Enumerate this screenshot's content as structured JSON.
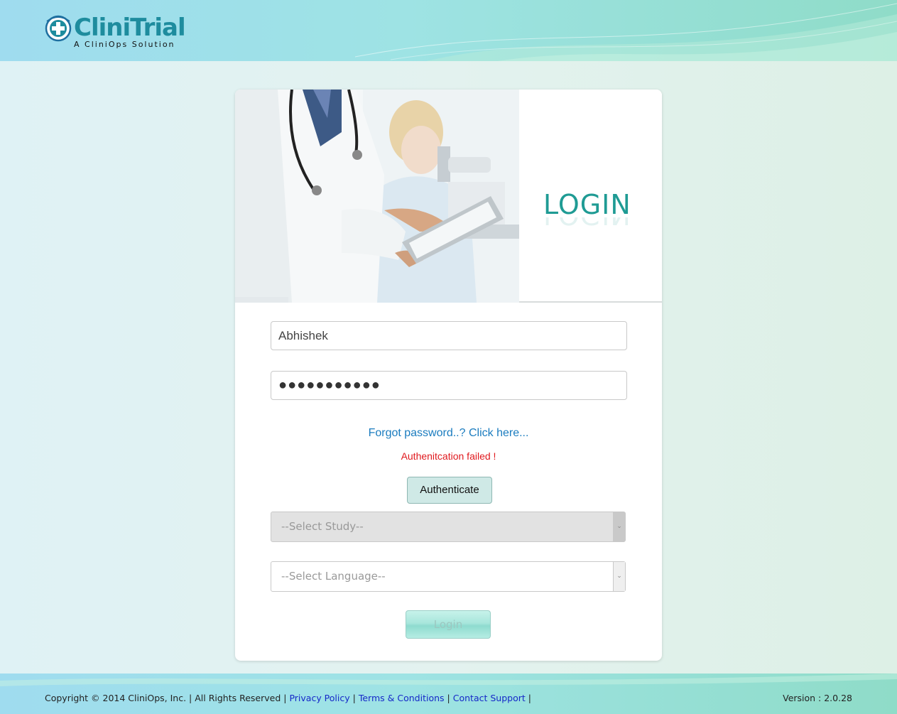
{
  "brand": {
    "name": "CliniTrial",
    "tagline": "A CliniOps Solution"
  },
  "login_card": {
    "title": "LOGIN",
    "username_value": "Abhishek",
    "password_masked": "●●●●●●●●●●●",
    "forgot_password": "Forgot password..? Click here...",
    "error_message": "Authenitcation failed !",
    "authenticate_label": "Authenticate",
    "study_select": "--Select Study--",
    "language_select": "--Select Language--",
    "login_label": "Login"
  },
  "footer": {
    "copyright": "Copyright © 2014 CliniOps, Inc. | All Rights Reserved |",
    "privacy": "Privacy Policy",
    "terms": "Terms & Conditions",
    "support": "Contact Support",
    "version": "Version : 2.0.28"
  },
  "colors": {
    "brand_teal": "#1f9b94",
    "error_red": "#e0191e",
    "link_blue": "#1b7cbf"
  }
}
